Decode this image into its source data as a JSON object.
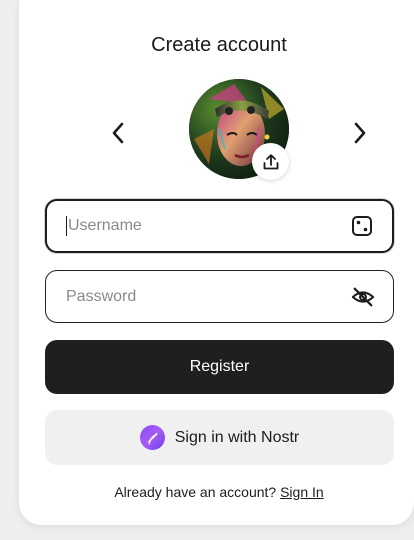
{
  "page": {
    "title": "Create account"
  },
  "avatar": {
    "prev_icon": "chevron-left-icon",
    "next_icon": "chevron-right-icon",
    "upload_icon": "upload-icon"
  },
  "username": {
    "value": "",
    "placeholder": "Username",
    "icon": "dice-icon"
  },
  "password": {
    "value": "",
    "placeholder": "Password",
    "icon": "eye-off-icon"
  },
  "register": {
    "label": "Register"
  },
  "nostr": {
    "label": "Sign in with Nostr",
    "icon": "nostr-ostrich-icon",
    "accent": "#8a4bff"
  },
  "footer": {
    "prompt": "Already have an account?",
    "link_label": "Sign In"
  },
  "colors": {
    "primary": "#1f1f1f",
    "secondary_bg": "#f0f0f0",
    "page_bg": "#eeeeee"
  }
}
